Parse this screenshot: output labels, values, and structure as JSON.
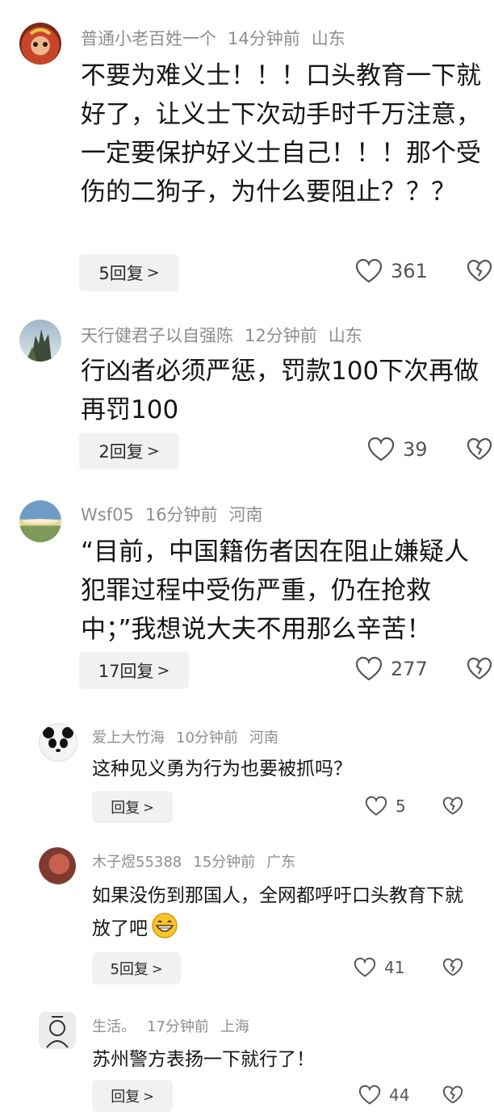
{
  "comments": [
    {
      "user": "普通小老百姓一个",
      "time": "14分钟前",
      "location": "山东",
      "text": "不要为难义士！！！口头教育一下就好了，让义士下次动手时千万注意，一定要保护好义士自己！！！那个受伤的二狗子，为什么要阻止？？？",
      "reply_label": "5回复",
      "likes": "361"
    },
    {
      "user": "天行健君子以自强陈",
      "time": "12分钟前",
      "location": "山东",
      "text": "行凶者必须严惩，罚款100下次再做再罚100",
      "reply_label": "2回复",
      "likes": "39"
    },
    {
      "user": "Wsf05",
      "time": "16分钟前",
      "location": "河南",
      "text": "“目前，中国籍伤者因在阻止嫌疑人犯罪过程中受伤严重，仍在抢救中；”我想说大夫不用那么辛苦！",
      "reply_label": "17回复",
      "likes": "277"
    },
    {
      "user": "爱上大竹海",
      "time": "10分钟前",
      "location": "河南",
      "text": "这种见义勇为行为也要被抓吗？",
      "reply_label": "回复",
      "likes": "5"
    },
    {
      "user": "木子煜55388",
      "time": "15分钟前",
      "location": "广东",
      "text": "如果没伤到那国人，全网都呼吁口头教育下就放了吧",
      "reply_label": "5回复",
      "likes": "41"
    },
    {
      "user": "生活。",
      "time": "17分钟前",
      "location": "上海",
      "text": "苏州警方表扬一下就行了！",
      "reply_label": "回复",
      "likes": "44"
    }
  ],
  "icons": {
    "like": "heart-outline-icon",
    "dislike": "broken-heart-icon",
    "emoji": "grinning-face-emoji"
  }
}
